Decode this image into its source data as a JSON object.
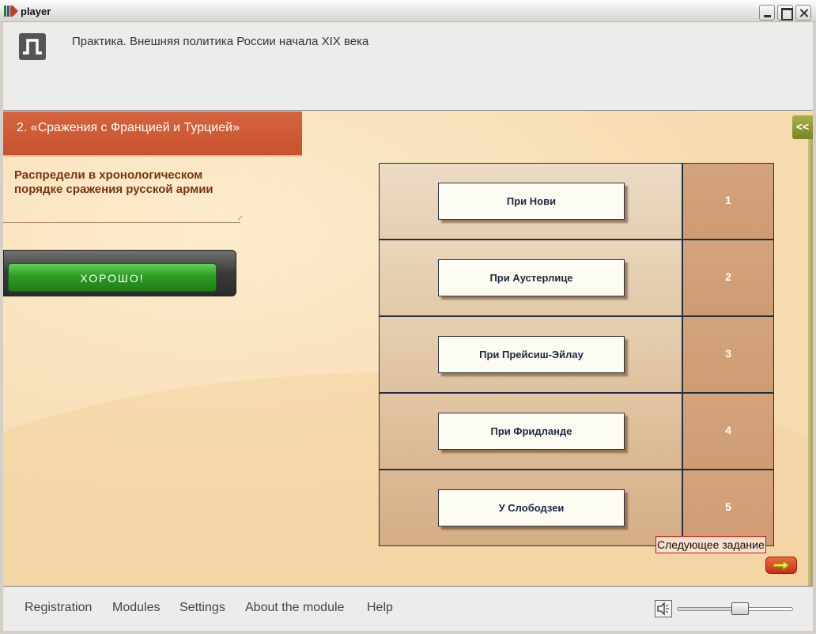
{
  "window": {
    "title": "player"
  },
  "header": {
    "page_title": "Практика. Внешняя политика России начала XIX века"
  },
  "section": {
    "title": "2. «Сражения с Францией и Турцией»",
    "instruction": "Распредели в хронологическом порядке сражения русской армии"
  },
  "feedback": {
    "text": "ХОРОШО!"
  },
  "panel_toggle": {
    "label": "<<"
  },
  "sort_rows": [
    {
      "card": "При Нови",
      "slot": "1"
    },
    {
      "card": "При Аустерлице",
      "slot": "2"
    },
    {
      "card": "При Прейсиш-Эйлау",
      "slot": "3"
    },
    {
      "card": "При Фридланде",
      "slot": "4"
    },
    {
      "card": "У Слободзеи",
      "slot": "5"
    }
  ],
  "next_task": {
    "label": "Следующее задание",
    "icon": "arrow-right-icon"
  },
  "footer": {
    "links": [
      "Registration",
      "Modules",
      "Settings",
      "About the module",
      "Help"
    ],
    "volume": {
      "icon": "speaker-icon",
      "level": 0.5
    }
  },
  "colors": {
    "section_header": "#c8522d",
    "feedback_green": "#2e9b23",
    "slot_cell": "#d3a37b",
    "next_button": "#c7311a"
  }
}
